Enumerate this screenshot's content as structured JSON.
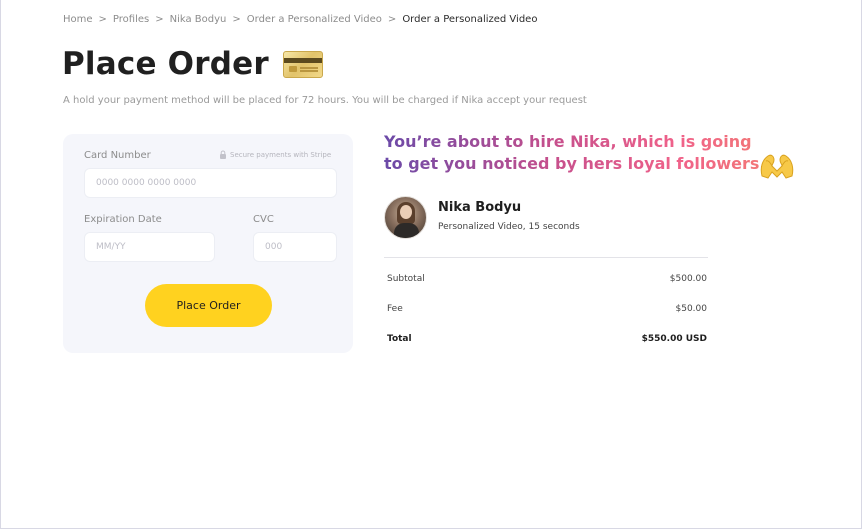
{
  "breadcrumb": {
    "items": [
      "Home",
      "Profiles",
      "Nika Bodyu",
      "Order a Personalized Video"
    ],
    "current": "Order a Personalized Video",
    "separator": ">"
  },
  "page": {
    "title": "Place Order",
    "subtitle": "A hold your payment method will be placed for 72 hours. You will be charged if Nika accept your request"
  },
  "payment_form": {
    "card_number_label": "Card Number",
    "secure_note": "Secure payments with Stripe",
    "card_number_placeholder": "0000 0000 0000 0000",
    "card_number_value": "",
    "expiration_label": "Expiration Date",
    "expiration_placeholder": "MM/YY",
    "expiration_value": "",
    "cvc_label": "CVC",
    "cvc_placeholder": "000",
    "cvc_value": "",
    "submit_label": "Place Order"
  },
  "summary": {
    "headline_line1": "You’re about to hire Nika, which is going",
    "headline_line2": "to get you noticed by hers loyal followers.",
    "creator_name": "Nika Bodyu",
    "product": "Personalized Video, 15 seconds",
    "rows": [
      {
        "label": "Subtotal",
        "value": "$500.00"
      },
      {
        "label": "Fee",
        "value": "$50.00"
      },
      {
        "label": "Total",
        "value": "$550.00 USD"
      }
    ]
  },
  "colors": {
    "accent_button": "#ffd21f",
    "headline_gradient_start": "#6b4aa8",
    "headline_gradient_end": "#f3826d",
    "card_background": "#f5f6fb"
  },
  "icons": [
    "credit-card-icon",
    "lock-icon",
    "heart-hands-icon"
  ]
}
